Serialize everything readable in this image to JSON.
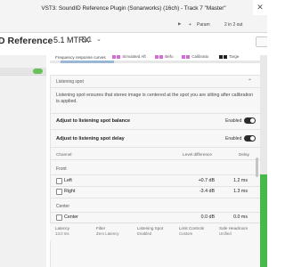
{
  "window": {
    "title": "VST3: SoundID Reference Plugin (Sonarworks) (16ch) - Track 7 \"Master\"",
    "close": "✕",
    "host_buttons": [
      "+",
      "Param",
      "2 in 2 out"
    ],
    "host_small": "▶"
  },
  "header": {
    "brand": "D Reference",
    "preset": "5.1 MTRX",
    "preset_version": "5.1",
    "preset_chevron": "⌄"
  },
  "legend": {
    "title": "Frequency response curves",
    "items": [
      {
        "badge": "L R",
        "label": "Simulated Aft",
        "color": "#d36bd8"
      },
      {
        "badge": "L R",
        "label": "Befo",
        "color": "#d36bd8"
      },
      {
        "badge": "L R",
        "label": "Calibratio",
        "color": "#d36bd8"
      },
      {
        "badge": "L R",
        "label": "Targe",
        "color": "#222222"
      }
    ]
  },
  "sidebar": {
    "status": "",
    "item": ""
  },
  "panel": {
    "header": "Listening spot",
    "chevron": "⌃",
    "description": "Listening spot ensures that stereo image is centered at the spot you are sitting after calibration is applied.",
    "settings": [
      {
        "label": "Adjust to listening spot balance",
        "state": "Enabled"
      },
      {
        "label": "Adjust to listening spot delay",
        "state": "Enabled"
      }
    ],
    "table_headers": {
      "channel": "Channel",
      "level": "Level difference",
      "delay": "Delay"
    },
    "groups": [
      {
        "name": "Front",
        "rows": [
          {
            "channel": "Left",
            "level": "+0.7 dB",
            "delay": "1.2 ms"
          },
          {
            "channel": "Right",
            "level": "-3.4 dB",
            "delay": "1.3 ms"
          }
        ]
      },
      {
        "name": "Center",
        "rows": [
          {
            "channel": "Center",
            "level": "0.0 dB",
            "delay": "0.0 ms"
          }
        ]
      }
    ]
  },
  "footer": {
    "stats": [
      {
        "label": "Latency",
        "value": "13.0 ms"
      },
      {
        "label": "Filter",
        "value": "Zero Latency"
      },
      {
        "label": "Listening Spot",
        "value": "Enabled"
      },
      {
        "label": "Limit Controls",
        "value": "Custom"
      },
      {
        "label": "Safe Headroom",
        "value": "Unified"
      }
    ]
  },
  "colors": {
    "accent_green": "#47b84a",
    "badge_pink": "#d36bd8"
  }
}
